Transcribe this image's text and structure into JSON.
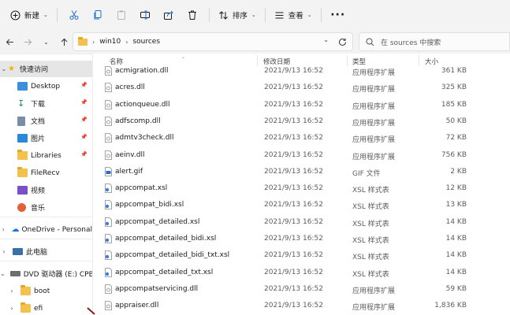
{
  "toolbar": {
    "new_label": "新建",
    "sort_label": "排序",
    "view_label": "查看"
  },
  "address": {
    "crumbs": [
      "win10",
      "sources"
    ],
    "search_placeholder": "在 sources 中搜索"
  },
  "columns": {
    "name": "名称",
    "date": "修改日期",
    "type": "类型",
    "size": "大小"
  },
  "sidebar": {
    "items": [
      {
        "label": "快速访问",
        "icon": "star-icon"
      },
      {
        "label": "Desktop",
        "icon": "desktop-folder-icon"
      },
      {
        "label": "下载",
        "icon": "download-icon"
      },
      {
        "label": "文档",
        "icon": "document-icon"
      },
      {
        "label": "图片",
        "icon": "picture-icon"
      },
      {
        "label": "Libraries",
        "icon": "folder-icon"
      },
      {
        "label": "FileRecv",
        "icon": "folder-icon"
      },
      {
        "label": "视频",
        "icon": "video-icon"
      },
      {
        "label": "音乐",
        "icon": "music-icon"
      },
      {
        "label": "OneDrive - Personal",
        "icon": "cloud-icon"
      },
      {
        "label": "此电脑",
        "icon": "pc-icon"
      },
      {
        "label": "DVD 驱动器 (E:) CPBA",
        "icon": "dvd-drive-icon"
      },
      {
        "label": "boot",
        "icon": "folder-icon"
      },
      {
        "label": "efi",
        "icon": "folder-icon"
      }
    ]
  },
  "files": [
    {
      "name": "acmigration.dll",
      "date": "2021/9/13 16:52",
      "type": "应用程序扩展",
      "size": "361 KB",
      "icon": "dll-icon"
    },
    {
      "name": "acres.dll",
      "date": "2021/9/13 16:52",
      "type": "应用程序扩展",
      "size": "325 KB",
      "icon": "dll-icon"
    },
    {
      "name": "actionqueue.dll",
      "date": "2021/9/13 16:52",
      "type": "应用程序扩展",
      "size": "185 KB",
      "icon": "dll-icon"
    },
    {
      "name": "adfscomp.dll",
      "date": "2021/9/13 16:52",
      "type": "应用程序扩展",
      "size": "50 KB",
      "icon": "dll-icon"
    },
    {
      "name": "admtv3check.dll",
      "date": "2021/9/13 16:52",
      "type": "应用程序扩展",
      "size": "72 KB",
      "icon": "dll-icon"
    },
    {
      "name": "aeinv.dll",
      "date": "2021/9/13 16:52",
      "type": "应用程序扩展",
      "size": "756 KB",
      "icon": "dll-icon"
    },
    {
      "name": "alert.gif",
      "date": "2021/9/13 16:52",
      "type": "GIF 文件",
      "size": "2 KB",
      "icon": "gif-icon"
    },
    {
      "name": "appcompat.xsl",
      "date": "2021/9/13 16:52",
      "type": "XSL 样式表",
      "size": "12 KB",
      "icon": "xsl-icon"
    },
    {
      "name": "appcompat_bidi.xsl",
      "date": "2021/9/13 16:52",
      "type": "XSL 样式表",
      "size": "13 KB",
      "icon": "xsl-icon"
    },
    {
      "name": "appcompat_detailed.xsl",
      "date": "2021/9/13 16:52",
      "type": "XSL 样式表",
      "size": "14 KB",
      "icon": "xsl-icon"
    },
    {
      "name": "appcompat_detailed_bidi.xsl",
      "date": "2021/9/13 16:52",
      "type": "XSL 样式表",
      "size": "14 KB",
      "icon": "xsl-icon"
    },
    {
      "name": "appcompat_detailed_bidi_txt.xsl",
      "date": "2021/9/13 16:52",
      "type": "XSL 样式表",
      "size": "14 KB",
      "icon": "xsl-icon"
    },
    {
      "name": "appcompat_detailed_txt.xsl",
      "date": "2021/9/13 16:52",
      "type": "XSL 样式表",
      "size": "14 KB",
      "icon": "xsl-icon"
    },
    {
      "name": "appcompatservicing.dll",
      "date": "2021/9/13 16:52",
      "type": "应用程序扩展",
      "size": "59 KB",
      "icon": "dll-icon"
    },
    {
      "name": "appraiser.dll",
      "date": "2021/9/13 16:52",
      "type": "应用程序扩展",
      "size": "1,836 KB",
      "icon": "dll-icon"
    }
  ]
}
